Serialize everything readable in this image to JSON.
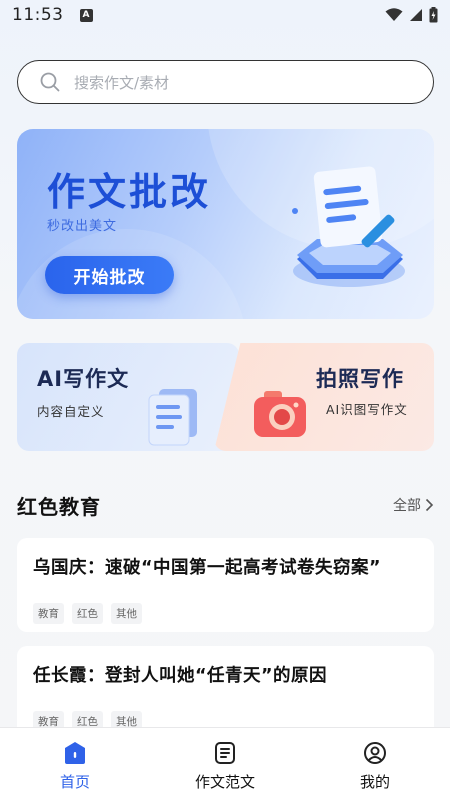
{
  "status": {
    "time": "11:53",
    "notification_glyph": "A"
  },
  "search": {
    "placeholder": "搜索作文/素材"
  },
  "banner": {
    "title": "作文批改",
    "subtitle": "秒改出美文",
    "button": "开始批改"
  },
  "cards": [
    {
      "title": "AI写作文",
      "subtitle": "内容自定义"
    },
    {
      "title": "拍照写作",
      "subtitle": "AI识图写作文"
    }
  ],
  "section": {
    "title": "红色教育",
    "more": "全部"
  },
  "articles": [
    {
      "title": "乌国庆：速破“中国第一起高考试卷失窃案”",
      "tags": [
        "教育",
        "红色",
        "其他"
      ]
    },
    {
      "title": "任长霞：登封人叫她“任青天”的原因",
      "tags": [
        "教育",
        "红色",
        "其他"
      ]
    }
  ],
  "tabs": [
    {
      "label": "首页",
      "active": true
    },
    {
      "label": "作文范文",
      "active": false
    },
    {
      "label": "我的",
      "active": false
    }
  ],
  "colors": {
    "primary": "#2f62e8",
    "banner_title": "#1d4fd6",
    "card_ai_bg": "#d7e4fb",
    "card_photo_bg": "#fde1d6"
  }
}
